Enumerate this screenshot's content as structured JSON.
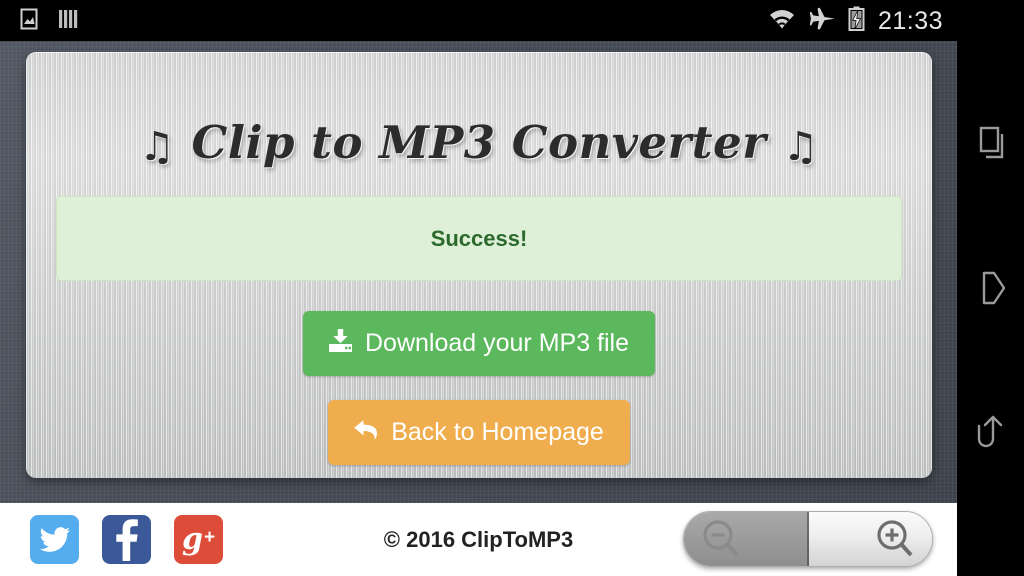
{
  "status_bar": {
    "time": "21:33",
    "icons_left": [
      "image-icon",
      "sim-bars-icon"
    ],
    "icons_right": [
      "wifi-icon",
      "airplane-mode-icon",
      "battery-charging-icon"
    ]
  },
  "page": {
    "title_note_left": "♫",
    "title_text": "Clip to MP3 Converter",
    "title_note_right": "♫",
    "alert": {
      "message": "Success!",
      "type": "success",
      "bg_color": "#dff0d8",
      "text_color": "#2d6a2d"
    },
    "buttons": [
      {
        "id": "download",
        "label": "Download your MP3 file",
        "icon": "download-icon",
        "color": "#5cb85c"
      },
      {
        "id": "homepage",
        "label": "Back to Homepage",
        "icon": "back-arrow-icon",
        "color": "#f0ad4e"
      }
    ]
  },
  "footer": {
    "copyright": "© 2016 ClipToMP3",
    "social": [
      {
        "name": "twitter",
        "label": "Twitter",
        "color": "#55acee"
      },
      {
        "name": "facebook",
        "label": "Facebook",
        "color": "#3b5998"
      },
      {
        "name": "googleplus",
        "label": "Google Plus",
        "glyph": "g",
        "plus": "+",
        "color": "#dd4b39"
      }
    ]
  },
  "zoom_controls": {
    "zoom_out_label": "Zoom out",
    "zoom_in_label": "Zoom in",
    "state": "zoom-out-pressed"
  },
  "nav_bar": {
    "buttons": [
      "recents-icon",
      "home-icon",
      "back-icon"
    ]
  }
}
